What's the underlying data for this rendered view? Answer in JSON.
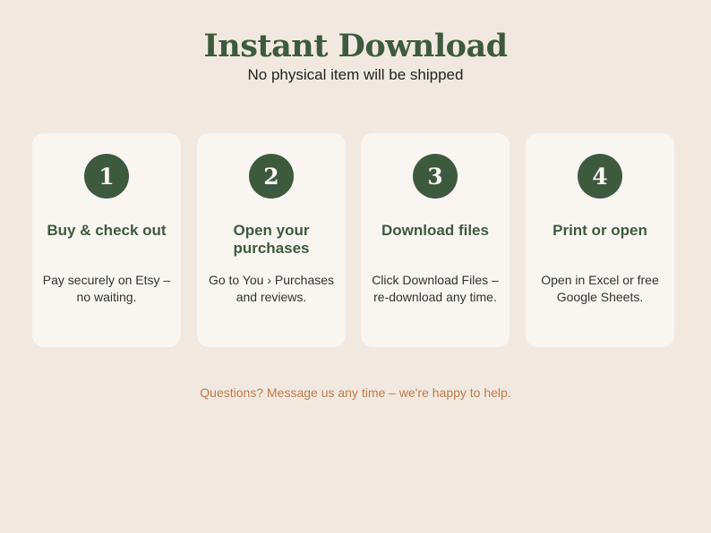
{
  "header": {
    "title": "Instant Download",
    "subtitle": "No physical item will be shipped"
  },
  "steps": [
    {
      "number": "1",
      "title": "Buy & check out",
      "description": "Pay securely on Etsy – no waiting."
    },
    {
      "number": "2",
      "title": "Open your purchases",
      "description": "Go to You › Purchases and reviews."
    },
    {
      "number": "3",
      "title": "Download files",
      "description": "Click Download Files – re-download any time."
    },
    {
      "number": "4",
      "title": "Print or open",
      "description": "Open in Excel or free Google Sheets."
    }
  ],
  "footer": {
    "note": "Questions? Message us any time – we're happy to help."
  },
  "colors": {
    "background": "#f1e9df",
    "card": "#f9f6f1",
    "accent_green": "#3e5a3e",
    "footer_text": "#c07a4c"
  }
}
